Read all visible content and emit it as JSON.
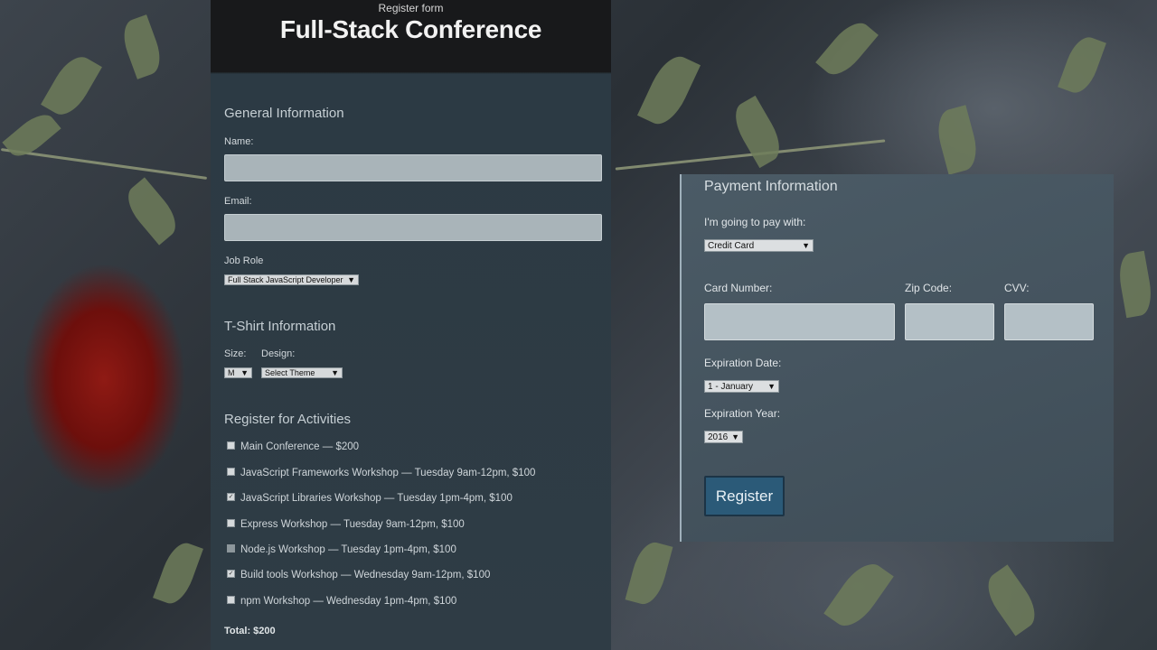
{
  "header": {
    "subtitle": "Register form",
    "title": "Full-Stack Conference"
  },
  "general": {
    "title": "General Information",
    "name_label": "Name:",
    "name_value": "",
    "email_label": "Email:",
    "email_value": "",
    "job_label": "Job Role",
    "job_value": "Full Stack JavaScript Developer"
  },
  "tshirt": {
    "title": "T-Shirt Information",
    "size_label": "Size:",
    "size_value": "M",
    "design_label": "Design:",
    "design_value": "Select Theme"
  },
  "activities": {
    "title": "Register for Activities",
    "items": [
      {
        "label": "Main Conference — $200",
        "checked": false
      },
      {
        "label": "JavaScript Frameworks Workshop — Tuesday 9am-12pm, $100",
        "checked": false
      },
      {
        "label": "JavaScript Libraries Workshop — Tuesday 1pm-4pm, $100",
        "checked": true
      },
      {
        "label": "Express Workshop — Tuesday 9am-12pm, $100",
        "checked": false
      },
      {
        "label": "Node.js Workshop — Tuesday 1pm-4pm, $100",
        "checked": false
      },
      {
        "label": "Build tools Workshop — Wednesday 9am-12pm, $100",
        "checked": true
      },
      {
        "label": "npm Workshop — Wednesday 1pm-4pm, $100",
        "checked": false
      }
    ],
    "total": "Total: $200"
  },
  "payment": {
    "title": "Payment Information",
    "method_label": "I'm going to pay with:",
    "method_value": "Credit Card",
    "card_label": "Card Number:",
    "zip_label": "Zip Code:",
    "cvv_label": "CVV:",
    "exp_date_label": "Expiration Date:",
    "exp_date_value": "1 - January",
    "exp_year_label": "Expiration Year:",
    "exp_year_value": "2016",
    "register_label": "Register"
  },
  "icons": {
    "dropdown": "dropdown-arrow-icon",
    "checkbox": "checkbox-icon"
  }
}
